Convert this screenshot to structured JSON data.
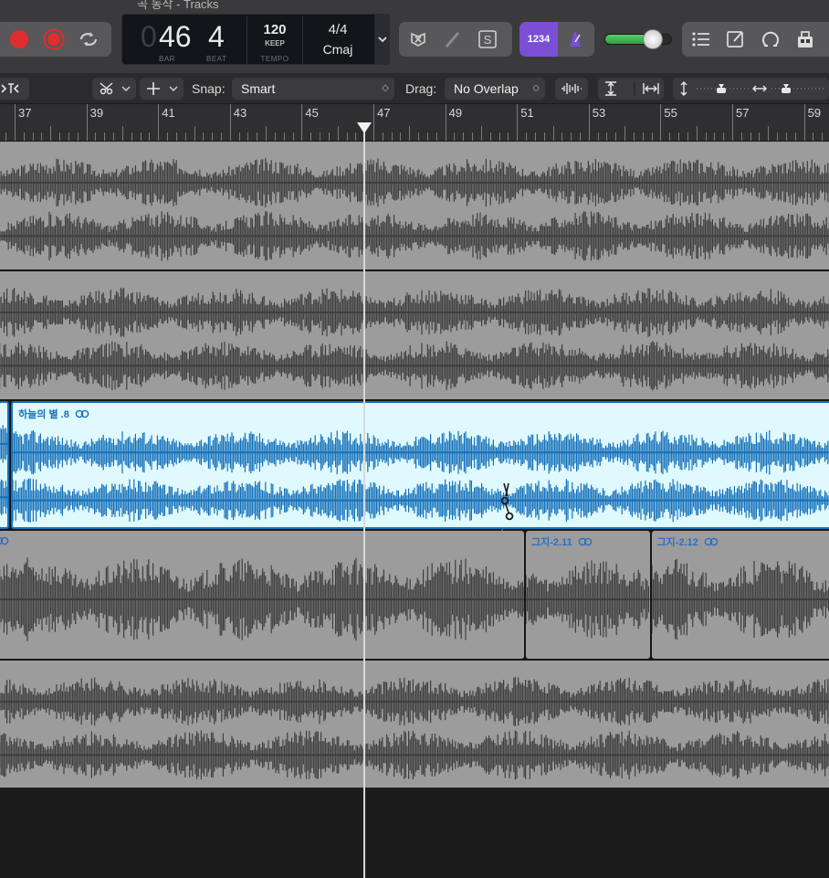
{
  "window": {
    "title": "곡 동작 - Tracks"
  },
  "lcd": {
    "bar_value": "46",
    "bar_prefix": "0",
    "beat_value": "4",
    "bar_caption": "BAR",
    "beat_caption": "BEAT",
    "tempo_value": "120",
    "tempo_mode": "KEEP",
    "tempo_caption": "TEMPO",
    "time_signature": "4/4",
    "key": "Cmaj"
  },
  "controlbar": {
    "count_in_label": "1234",
    "master_volume_level": 0.72
  },
  "toolbar": {
    "snap_label": "Snap:",
    "snap_value": "Smart",
    "drag_label": "Drag:",
    "drag_value": "No Overlap"
  },
  "ruler": {
    "bars": [
      "37",
      "39",
      "41",
      "43",
      "45",
      "47",
      "49",
      "51",
      "53",
      "55",
      "57",
      "59"
    ],
    "playhead_bar": 46.75
  },
  "tracks": [
    {
      "id": "track-1",
      "color": "#9c9c9c",
      "wave": "#3e3e3e",
      "regions": [
        {
          "name": "",
          "start": 36,
          "end": 60
        }
      ]
    },
    {
      "id": "track-2",
      "color": "#9c9c9c",
      "wave": "#3e3e3e",
      "regions": [
        {
          "name": "",
          "start": 36,
          "end": 60
        }
      ]
    },
    {
      "id": "track-3",
      "color": "#dff9ff",
      "wave": "#1670b8",
      "selected": true,
      "regions": [
        {
          "name": "",
          "start": 36,
          "end": 36.85
        },
        {
          "name": "하늘의 별 .8",
          "start": 36.9,
          "end": 60
        }
      ]
    },
    {
      "id": "track-4",
      "color": "#9c9c9c",
      "wave": "#3e3e3e",
      "regions": [
        {
          "name": "",
          "start": 36,
          "end": 51.2
        },
        {
          "name": "그지-2.11",
          "start": 51.25,
          "end": 54.7
        },
        {
          "name": "그지-2.12",
          "start": 54.75,
          "end": 60
        }
      ]
    },
    {
      "id": "track-5",
      "color": "#9c9c9c",
      "wave": "#3e3e3e",
      "regions": [
        {
          "name": "",
          "start": 36,
          "end": 60
        }
      ]
    }
  ],
  "icons": {
    "record": "record-icon",
    "replace": "replace-icon",
    "cycle": "cycle-icon",
    "autopunch": "autopunch-icon",
    "tuner": "tuner-icon",
    "solo": "solo-icon",
    "metronome": "metronome-icon",
    "list": "list-editors-icon",
    "notepad": "notepad-icon",
    "loops": "loop-browser-icon",
    "browsers": "browsers-icon",
    "scissors": "scissors-cursor-icon"
  },
  "colors": {
    "record": "#e02d2d",
    "accent_purple": "#7a4fd6",
    "selected_region": "#1670b8"
  }
}
